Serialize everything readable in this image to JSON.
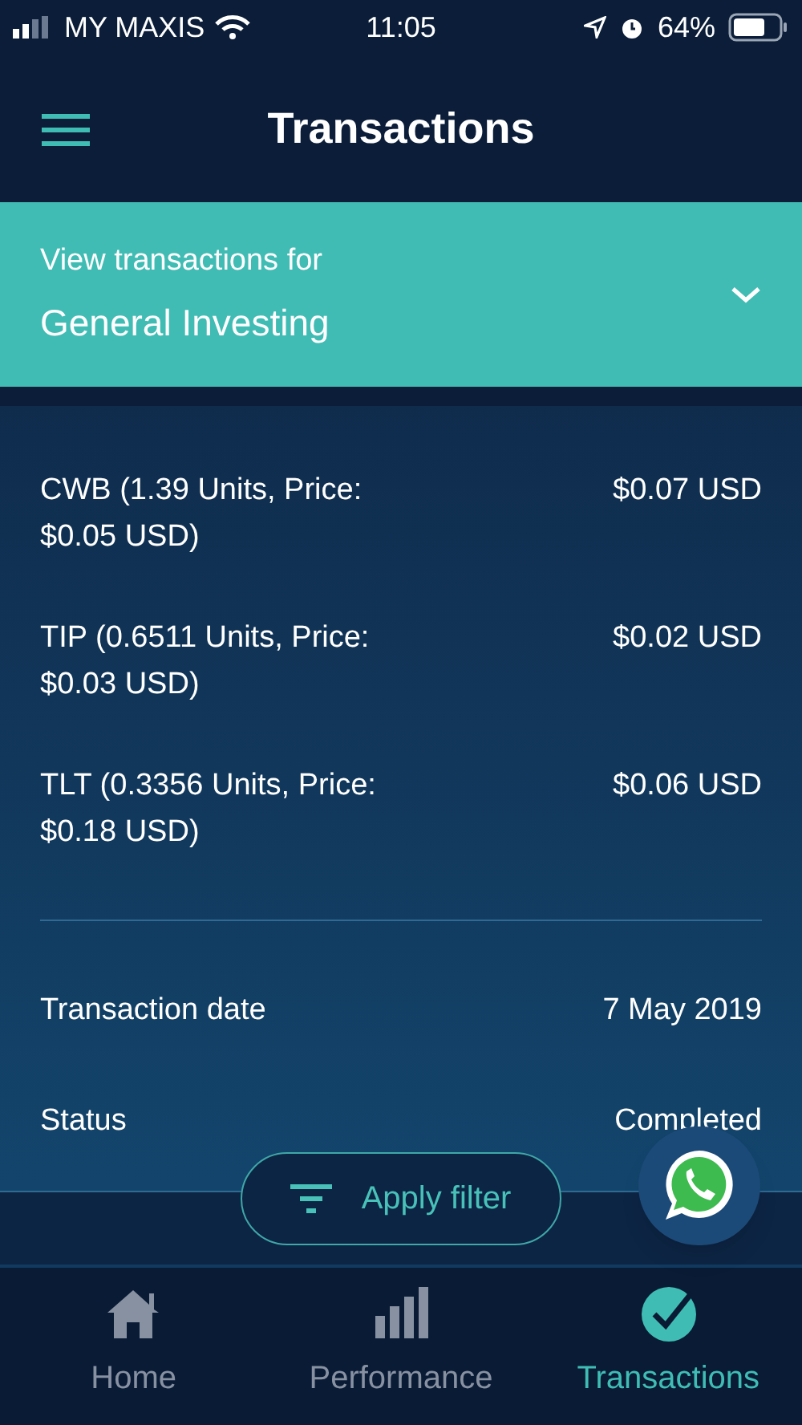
{
  "status_bar": {
    "carrier": "MY MAXIS",
    "time": "11:05",
    "battery": "64%"
  },
  "header": {
    "title": "Transactions"
  },
  "account_selector": {
    "label": "View transactions for",
    "value": "General Investing"
  },
  "transaction": {
    "holdings": [
      {
        "description": "CWB (1.39 Units, Price: $0.05 USD)",
        "amount": "$0.07 USD"
      },
      {
        "description": "TIP (0.6511 Units, Price: $0.03 USD)",
        "amount": "$0.02 USD"
      },
      {
        "description": "TLT (0.3356 Units, Price: $0.18 USD)",
        "amount": "$0.06 USD"
      }
    ],
    "details": [
      {
        "label": "Transaction date",
        "value": "7 May 2019"
      },
      {
        "label": "Status",
        "value": "Completed"
      }
    ]
  },
  "filter_button": {
    "label": "Apply filter"
  },
  "tab_bar": [
    {
      "kind": "home",
      "label": "Home",
      "selected": false
    },
    {
      "kind": "performance",
      "label": "Performance",
      "selected": false
    },
    {
      "kind": "transactions",
      "label": "Transactions",
      "selected": true
    }
  ]
}
